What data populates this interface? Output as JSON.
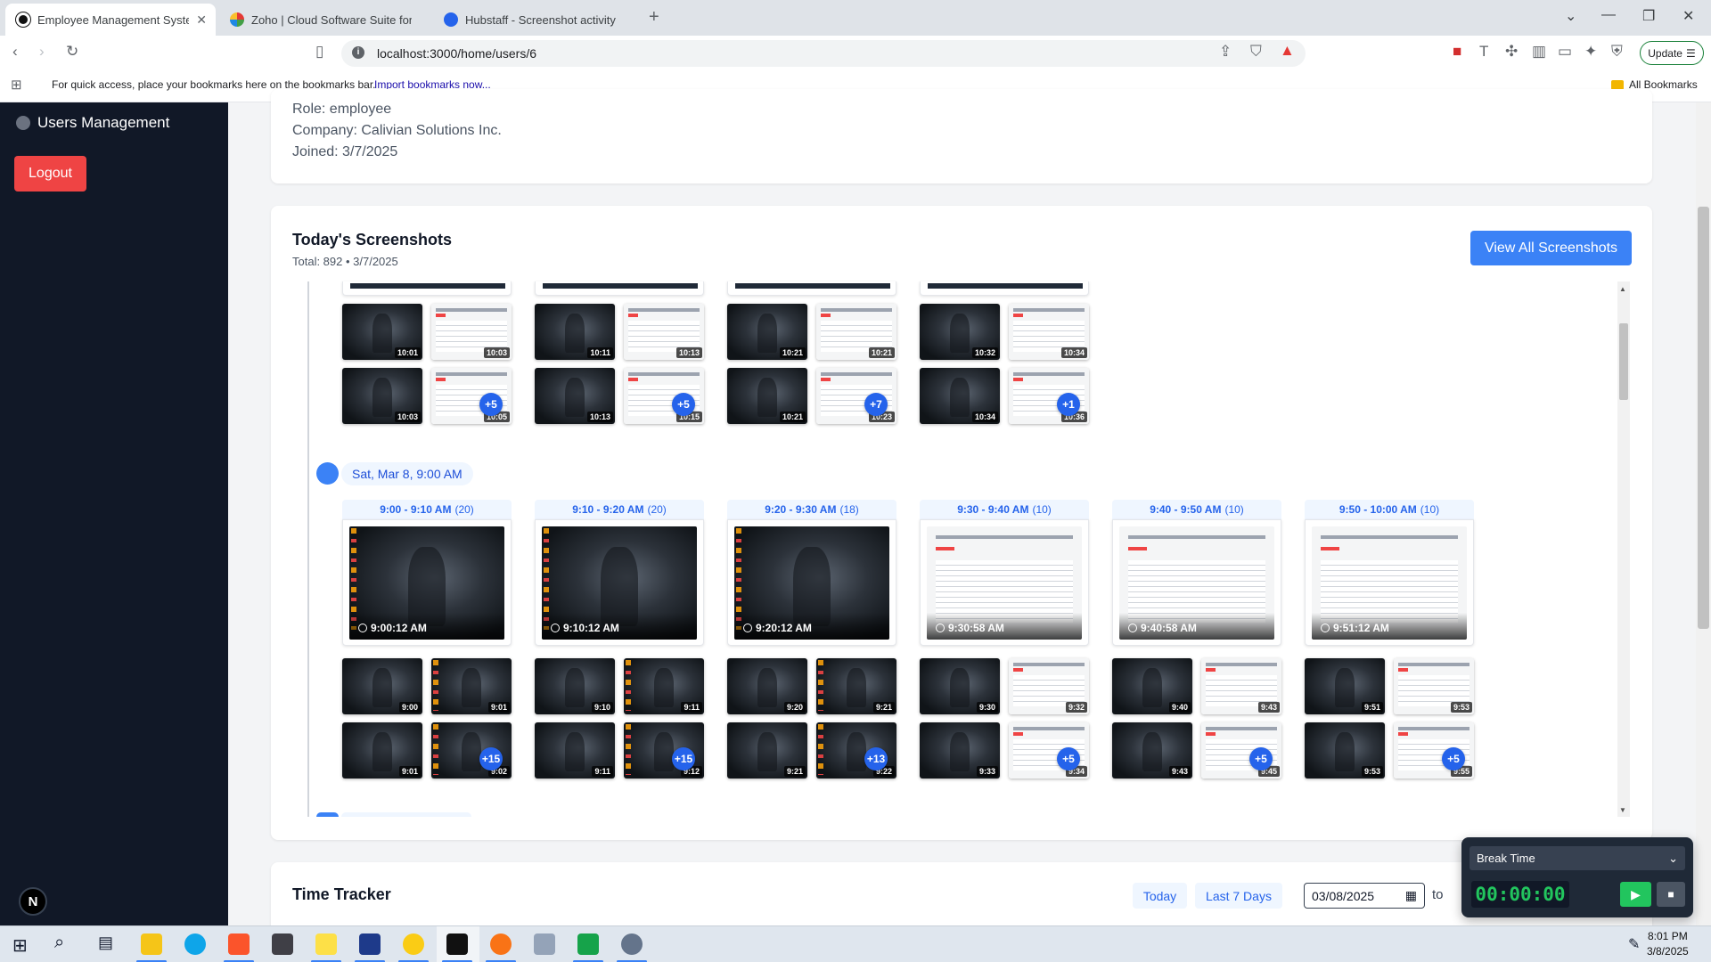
{
  "browser": {
    "tabs": [
      {
        "title": "Employee Management System"
      },
      {
        "title": "Zoho | Cloud Software Suite for Bus"
      },
      {
        "title": "Hubstaff - Screenshot activity"
      }
    ],
    "url": "localhost:3000/home/users/6",
    "update_label": "Update",
    "bookmarks_hint": "For quick access, place your bookmarks here on the bookmarks bar.",
    "import_link": "Import bookmarks now...",
    "all_bookmarks": "All Bookmarks"
  },
  "sidebar": {
    "title": "Users Management",
    "logout": "Logout",
    "badge": "N"
  },
  "profile": {
    "role": "Role: employee",
    "company": "Company: Calivian Solutions Inc.",
    "joined": "Joined: 3/7/2025"
  },
  "screenshots": {
    "title": "Today's Screenshots",
    "subtitle": "Total: 892 • 3/7/2025",
    "view_all": "View All Screenshots",
    "prev_group": {
      "blocks": [
        {
          "row1": [
            "10:01",
            "10:03"
          ],
          "row2": [
            "10:03",
            "10:05"
          ],
          "more": "+5"
        },
        {
          "row1": [
            "10:11",
            "10:13"
          ],
          "row2": [
            "10:13",
            "10:15"
          ],
          "more": "+5"
        },
        {
          "row1": [
            "10:21",
            "10:21"
          ],
          "row2": [
            "10:21",
            "10:23"
          ],
          "more": "+7"
        },
        {
          "row1": [
            "10:32",
            "10:34"
          ],
          "row2": [
            "10:34",
            "10:36"
          ],
          "more": "+1"
        }
      ]
    },
    "group": {
      "label": "Sat, Mar 8, 9:00 AM",
      "blocks": [
        {
          "range": "9:00 - 9:10 AM",
          "count": "(20)",
          "time": "9:00:12 AM",
          "row1": [
            "9:00",
            "9:01"
          ],
          "row2": [
            "9:01",
            "9:02"
          ],
          "more": "+15"
        },
        {
          "range": "9:10 - 9:20 AM",
          "count": "(20)",
          "time": "9:10:12 AM",
          "row1": [
            "9:10",
            "9:11"
          ],
          "row2": [
            "9:11",
            "9:12"
          ],
          "more": "+15"
        },
        {
          "range": "9:20 - 9:30 AM",
          "count": "(18)",
          "time": "9:20:12 AM",
          "row1": [
            "9:20",
            "9:21"
          ],
          "row2": [
            "9:21",
            "9:22"
          ],
          "more": "+13"
        },
        {
          "range": "9:30 - 9:40 AM",
          "count": "(10)",
          "time": "9:30:58 AM",
          "row1": [
            "9:30",
            "9:32"
          ],
          "row2": [
            "9:33",
            "9:34"
          ],
          "more": "+5"
        },
        {
          "range": "9:40 - 9:50 AM",
          "count": "(10)",
          "time": "9:40:58 AM",
          "row1": [
            "9:40",
            "9:43"
          ],
          "row2": [
            "9:43",
            "9:45"
          ],
          "more": "+5"
        },
        {
          "range": "9:50 - 10:00 AM",
          "count": "(10)",
          "time": "9:51:12 AM",
          "row1": [
            "9:51",
            "9:53"
          ],
          "row2": [
            "9:53",
            "9:55"
          ],
          "more": "+5"
        }
      ]
    }
  },
  "time_tracker": {
    "title": "Time Tracker",
    "today": "Today",
    "last7": "Last 7 Days",
    "date_from": "03/08/2025",
    "to": "to"
  },
  "timer_widget": {
    "mode": "Break Time",
    "elapsed": "00:00:00"
  },
  "taskbar": {
    "time": "8:01 PM",
    "date": "3/8/2025"
  },
  "colors": {
    "accent": "#3b82f6",
    "sidebar_bg": "#111827",
    "logout": "#ef4444",
    "timer_green": "#22c55e"
  }
}
